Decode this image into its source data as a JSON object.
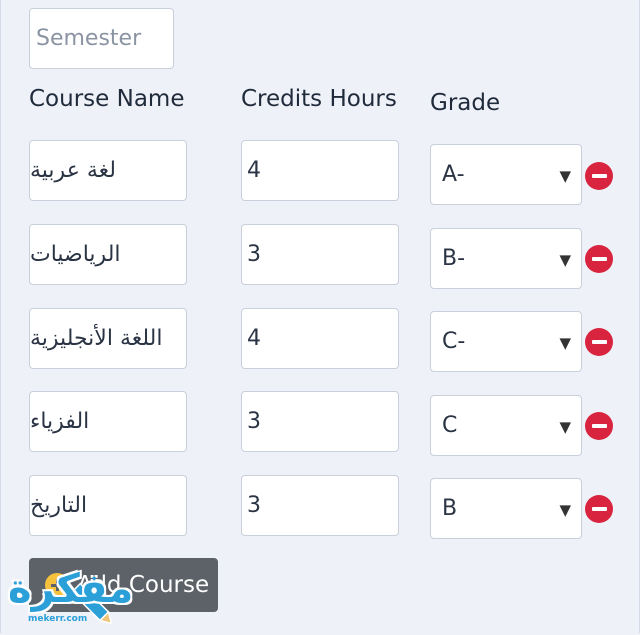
{
  "semester": {
    "placeholder": "Semester"
  },
  "headers": {
    "course_name": "Course Name",
    "credits": "Credits Hours",
    "grade": "Grade"
  },
  "rows": [
    {
      "course": "لغة عربية",
      "credits": "4",
      "grade": "A-"
    },
    {
      "course": "الرياضيات",
      "credits": "3",
      "grade": "B-"
    },
    {
      "course": "اللغة الأنجليزية",
      "credits": "4",
      "grade": "C-"
    },
    {
      "course": "الفزياء",
      "credits": "3",
      "grade": "C"
    },
    {
      "course": "التاريخ",
      "credits": "3",
      "grade": "B"
    }
  ],
  "add_button": {
    "label": "Add Course"
  },
  "watermark": {
    "text": "مفكرة",
    "url": "mekerr.com"
  },
  "icons": {
    "remove": "minus-circle-icon",
    "add": "plus-circle-icon",
    "caret": "caret-down-icon"
  },
  "colors": {
    "remove": "#d9243f",
    "button": "#5d6269",
    "add_icon": "#f6c23e",
    "watermark": "#2a9fd8"
  }
}
